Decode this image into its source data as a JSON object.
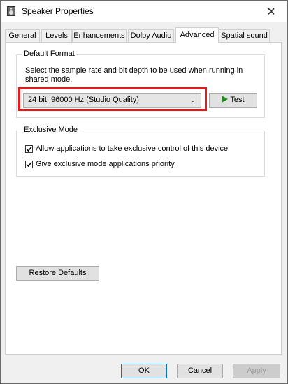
{
  "window": {
    "title": "Speaker Properties",
    "icon": "speaker-icon",
    "close_glyph": "✕"
  },
  "tabs": [
    {
      "label": "General",
      "active": false
    },
    {
      "label": "Levels",
      "active": false
    },
    {
      "label": "Enhancements",
      "active": false
    },
    {
      "label": "Dolby Audio",
      "active": false
    },
    {
      "label": "Advanced",
      "active": true
    },
    {
      "label": "Spatial sound",
      "active": false
    }
  ],
  "default_format": {
    "group_label": "Default Format",
    "description": "Select the sample rate and bit depth to be used when running in shared mode.",
    "selected_value": "24 bit, 96000 Hz (Studio Quality)",
    "test_label": "Test",
    "highlight_color": "#e51b1b"
  },
  "exclusive_mode": {
    "group_label": "Exclusive Mode",
    "options": [
      {
        "label": "Allow applications to take exclusive control of this device",
        "checked": true
      },
      {
        "label": "Give exclusive mode applications priority",
        "checked": true
      }
    ]
  },
  "buttons": {
    "restore_defaults": "Restore Defaults",
    "ok": "OK",
    "cancel": "Cancel",
    "apply": "Apply"
  },
  "colors": {
    "accent": "#0078d7",
    "test_play": "#1e8b1e"
  }
}
